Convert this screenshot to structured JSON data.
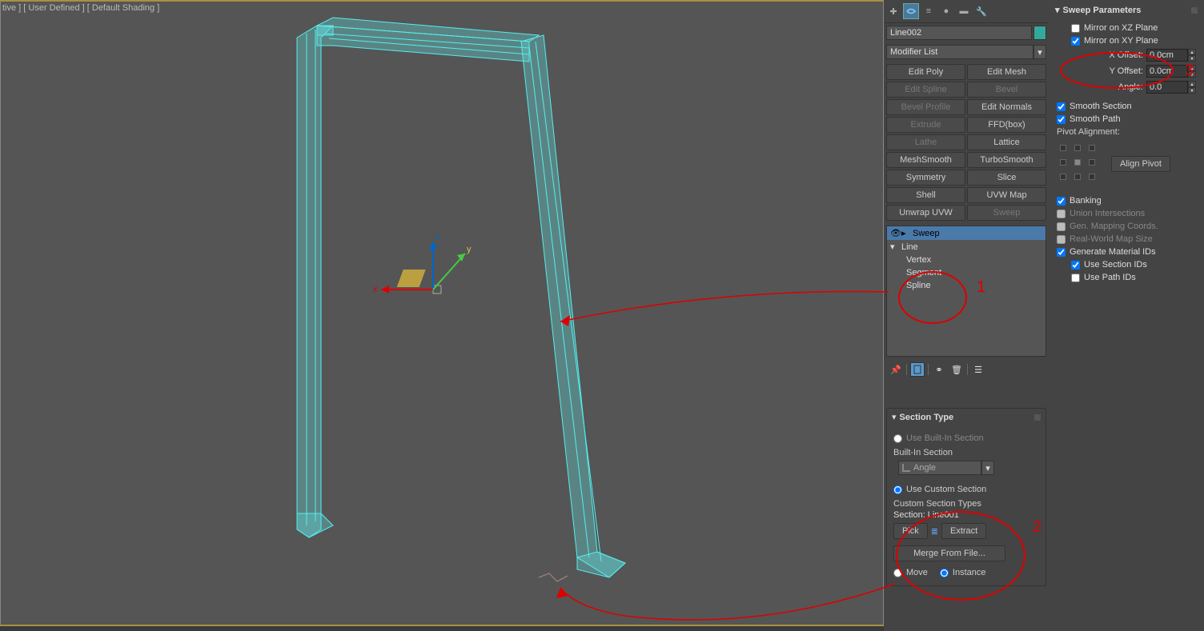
{
  "viewport": {
    "label": "tive ] [ User Defined ] [ Default Shading ]"
  },
  "cmdpanel": {
    "object_name": "Line002",
    "modifier_list_placeholder": "Modifier List",
    "buttons": [
      {
        "label": "Edit Poly",
        "disabled": false
      },
      {
        "label": "Edit Mesh",
        "disabled": false
      },
      {
        "label": "Edit Spline",
        "disabled": true
      },
      {
        "label": "Bevel",
        "disabled": true
      },
      {
        "label": "Bevel Profile",
        "disabled": true
      },
      {
        "label": "Edit Normals",
        "disabled": false
      },
      {
        "label": "Extrude",
        "disabled": true
      },
      {
        "label": "FFD(box)",
        "disabled": false
      },
      {
        "label": "Lathe",
        "disabled": true
      },
      {
        "label": "Lattice",
        "disabled": false
      },
      {
        "label": "MeshSmooth",
        "disabled": false
      },
      {
        "label": "TurboSmooth",
        "disabled": false
      },
      {
        "label": "Symmetry",
        "disabled": false
      },
      {
        "label": "Slice",
        "disabled": false
      },
      {
        "label": "Shell",
        "disabled": false
      },
      {
        "label": "UVW Map",
        "disabled": false
      },
      {
        "label": "Unwrap UVW",
        "disabled": false
      },
      {
        "label": "Sweep",
        "disabled": true
      }
    ],
    "stack": {
      "sweep": "Sweep",
      "line": "Line",
      "vertex": "Vertex",
      "segment": "Segment",
      "spline": "Spline"
    }
  },
  "section_type": {
    "title": "Section Type",
    "use_builtin": "Use Built-In Section",
    "builtin_label": "Built-In Section",
    "angle": "Angle",
    "use_custom": "Use Custom Section",
    "custom_types": "Custom Section Types",
    "section_label": "Section:",
    "section_value": "Line001",
    "pick": "Pick",
    "extract": "Extract",
    "merge": "Merge From File...",
    "move": "Move",
    "instance": "Instance"
  },
  "sweep_params": {
    "title": "Sweep Parameters",
    "mirror_xz": "Mirror on XZ Plane",
    "mirror_xy": "Mirror on XY Plane",
    "x_offset_label": "X Offset:",
    "x_offset_value": "0.0cm",
    "y_offset_label": "Y Offset:",
    "y_offset_value": "0.0cm",
    "angle_label": "Angle:",
    "angle_value": "0.0",
    "smooth_section": "Smooth Section",
    "smooth_path": "Smooth Path",
    "pivot_alignment": "Pivot Alignment:",
    "align_pivot": "Align Pivot",
    "banking": "Banking",
    "union_intersections": "Union Intersections",
    "gen_mapping": "Gen. Mapping Coords.",
    "real_world": "Real-World Map Size",
    "gen_material": "Generate Material IDs",
    "use_section_ids": "Use Section IDs",
    "use_path_ids": "Use Path IDs"
  },
  "gizmo": {
    "x": "x",
    "y": "y",
    "z": "z"
  },
  "annotations": {
    "n1": "1",
    "n2": "2",
    "n3": "3"
  }
}
